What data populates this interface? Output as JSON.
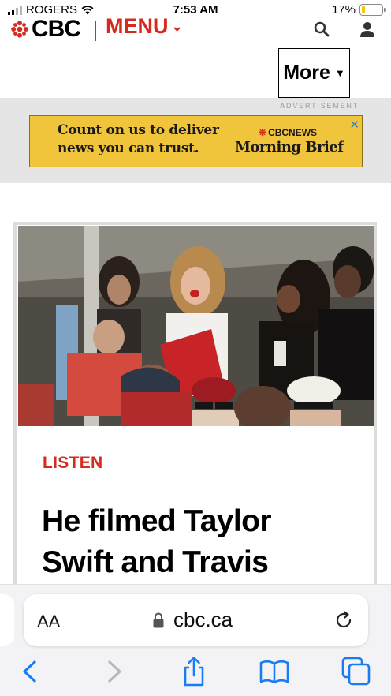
{
  "status_bar": {
    "carrier": "ROGERS",
    "time": "7:53 AM",
    "battery": "17%"
  },
  "header": {
    "logo_text": "CBC",
    "menu_label": "MENU",
    "brand_color": "#d52b1e"
  },
  "more_button": {
    "label": "More"
  },
  "ad": {
    "label": "ADVERTISEMENT",
    "line1": "Count on us to deliver",
    "line2": "news you can trust.",
    "brand": "CBCNEWS",
    "product": "Morning Brief",
    "background": "#f0c43b"
  },
  "article": {
    "kicker": "LISTEN",
    "headline_line1": "He filmed Taylor",
    "headline_line2": "Swift and Travis"
  },
  "browser": {
    "text_size_label": "AA",
    "url": "cbc.ca",
    "tint": "#1a7cf5"
  }
}
